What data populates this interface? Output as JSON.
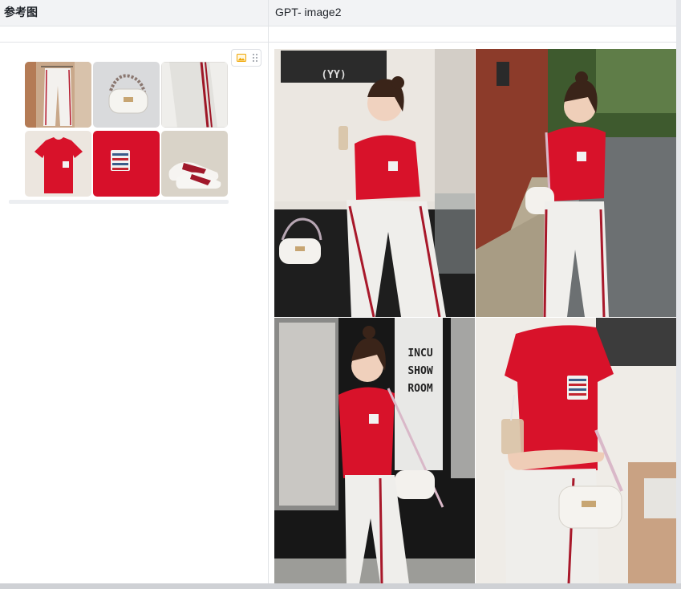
{
  "table": {
    "columns": [
      {
        "label": "参考图"
      },
      {
        "label": "GPT- image2"
      }
    ]
  },
  "reference_thumbnails": [
    {
      "icon": "white-pants-photo"
    },
    {
      "icon": "white-handbag-photo"
    },
    {
      "icon": "striped-pants-closeup-photo"
    },
    {
      "icon": "red-tshirt-photo"
    },
    {
      "icon": "red-tshirt-embroidery-closeup-photo"
    },
    {
      "icon": "red-white-sneakers-photo"
    }
  ],
  "generated_images": [
    {
      "icon": "model-sitting-photo",
      "sign_text": "(YY)"
    },
    {
      "icon": "model-street-photo"
    },
    {
      "icon": "model-shop-window-photo",
      "sign_lines": [
        "INCU",
        "SHOW",
        "ROOM"
      ]
    },
    {
      "icon": "model-closeup-photo"
    }
  ],
  "colors": {
    "header_bg": "#f2f3f5",
    "border": "#e1e3e6",
    "tshirt_red": "#d8122a"
  }
}
